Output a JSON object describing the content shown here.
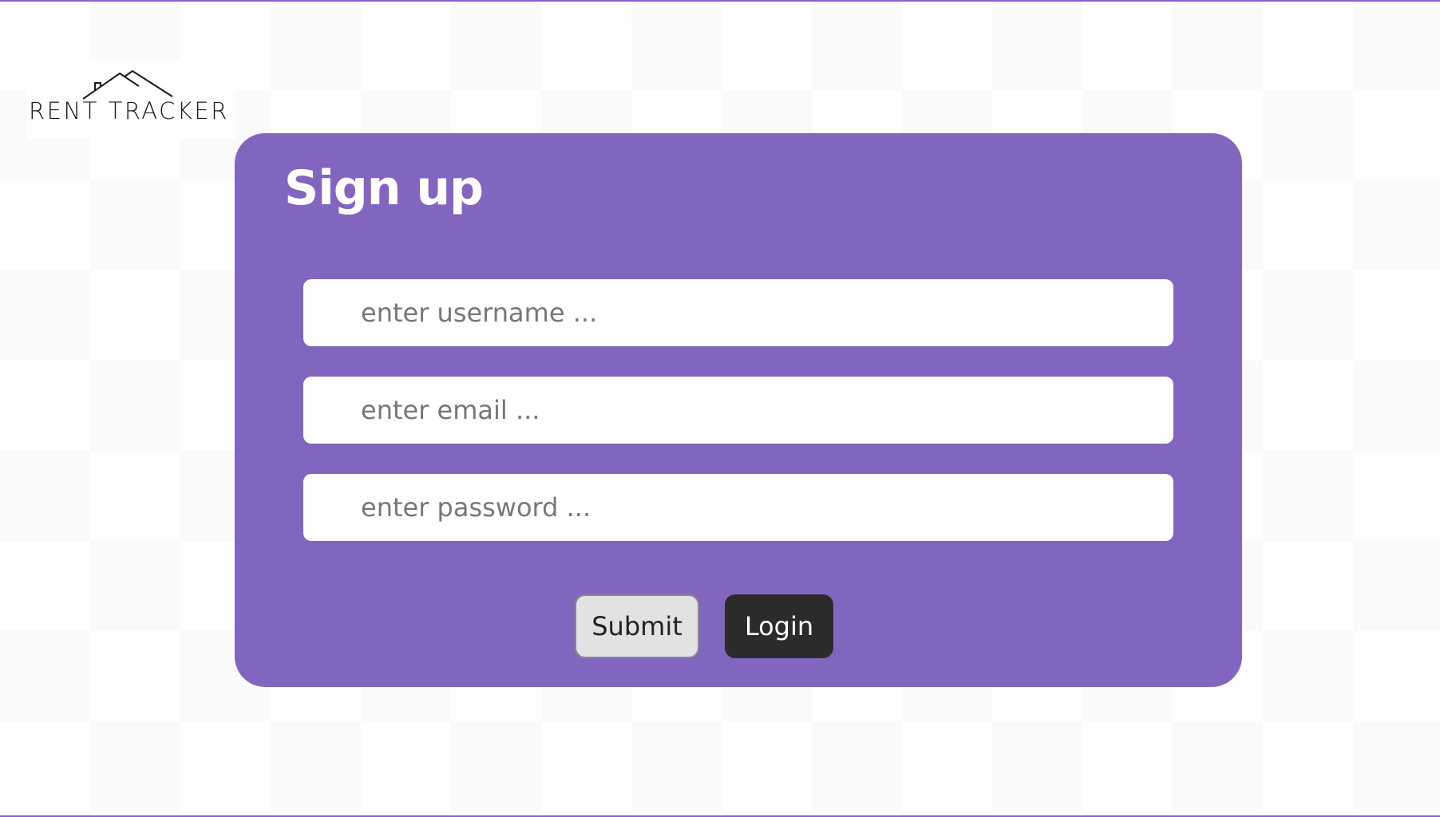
{
  "brand": {
    "name": "RENT TRACKER"
  },
  "signup": {
    "title": "Sign up",
    "username_placeholder": "enter username ...",
    "email_placeholder": "enter email ...",
    "password_placeholder": "enter password ...",
    "submit_label": "Submit",
    "login_label": "Login"
  },
  "colors": {
    "card": "#8265bf",
    "accent_border": "#8a5fd0",
    "submit_bg": "#e2e2e2",
    "login_bg": "#2b2b2b"
  },
  "icons": {
    "logo": "house-roof-icon"
  }
}
